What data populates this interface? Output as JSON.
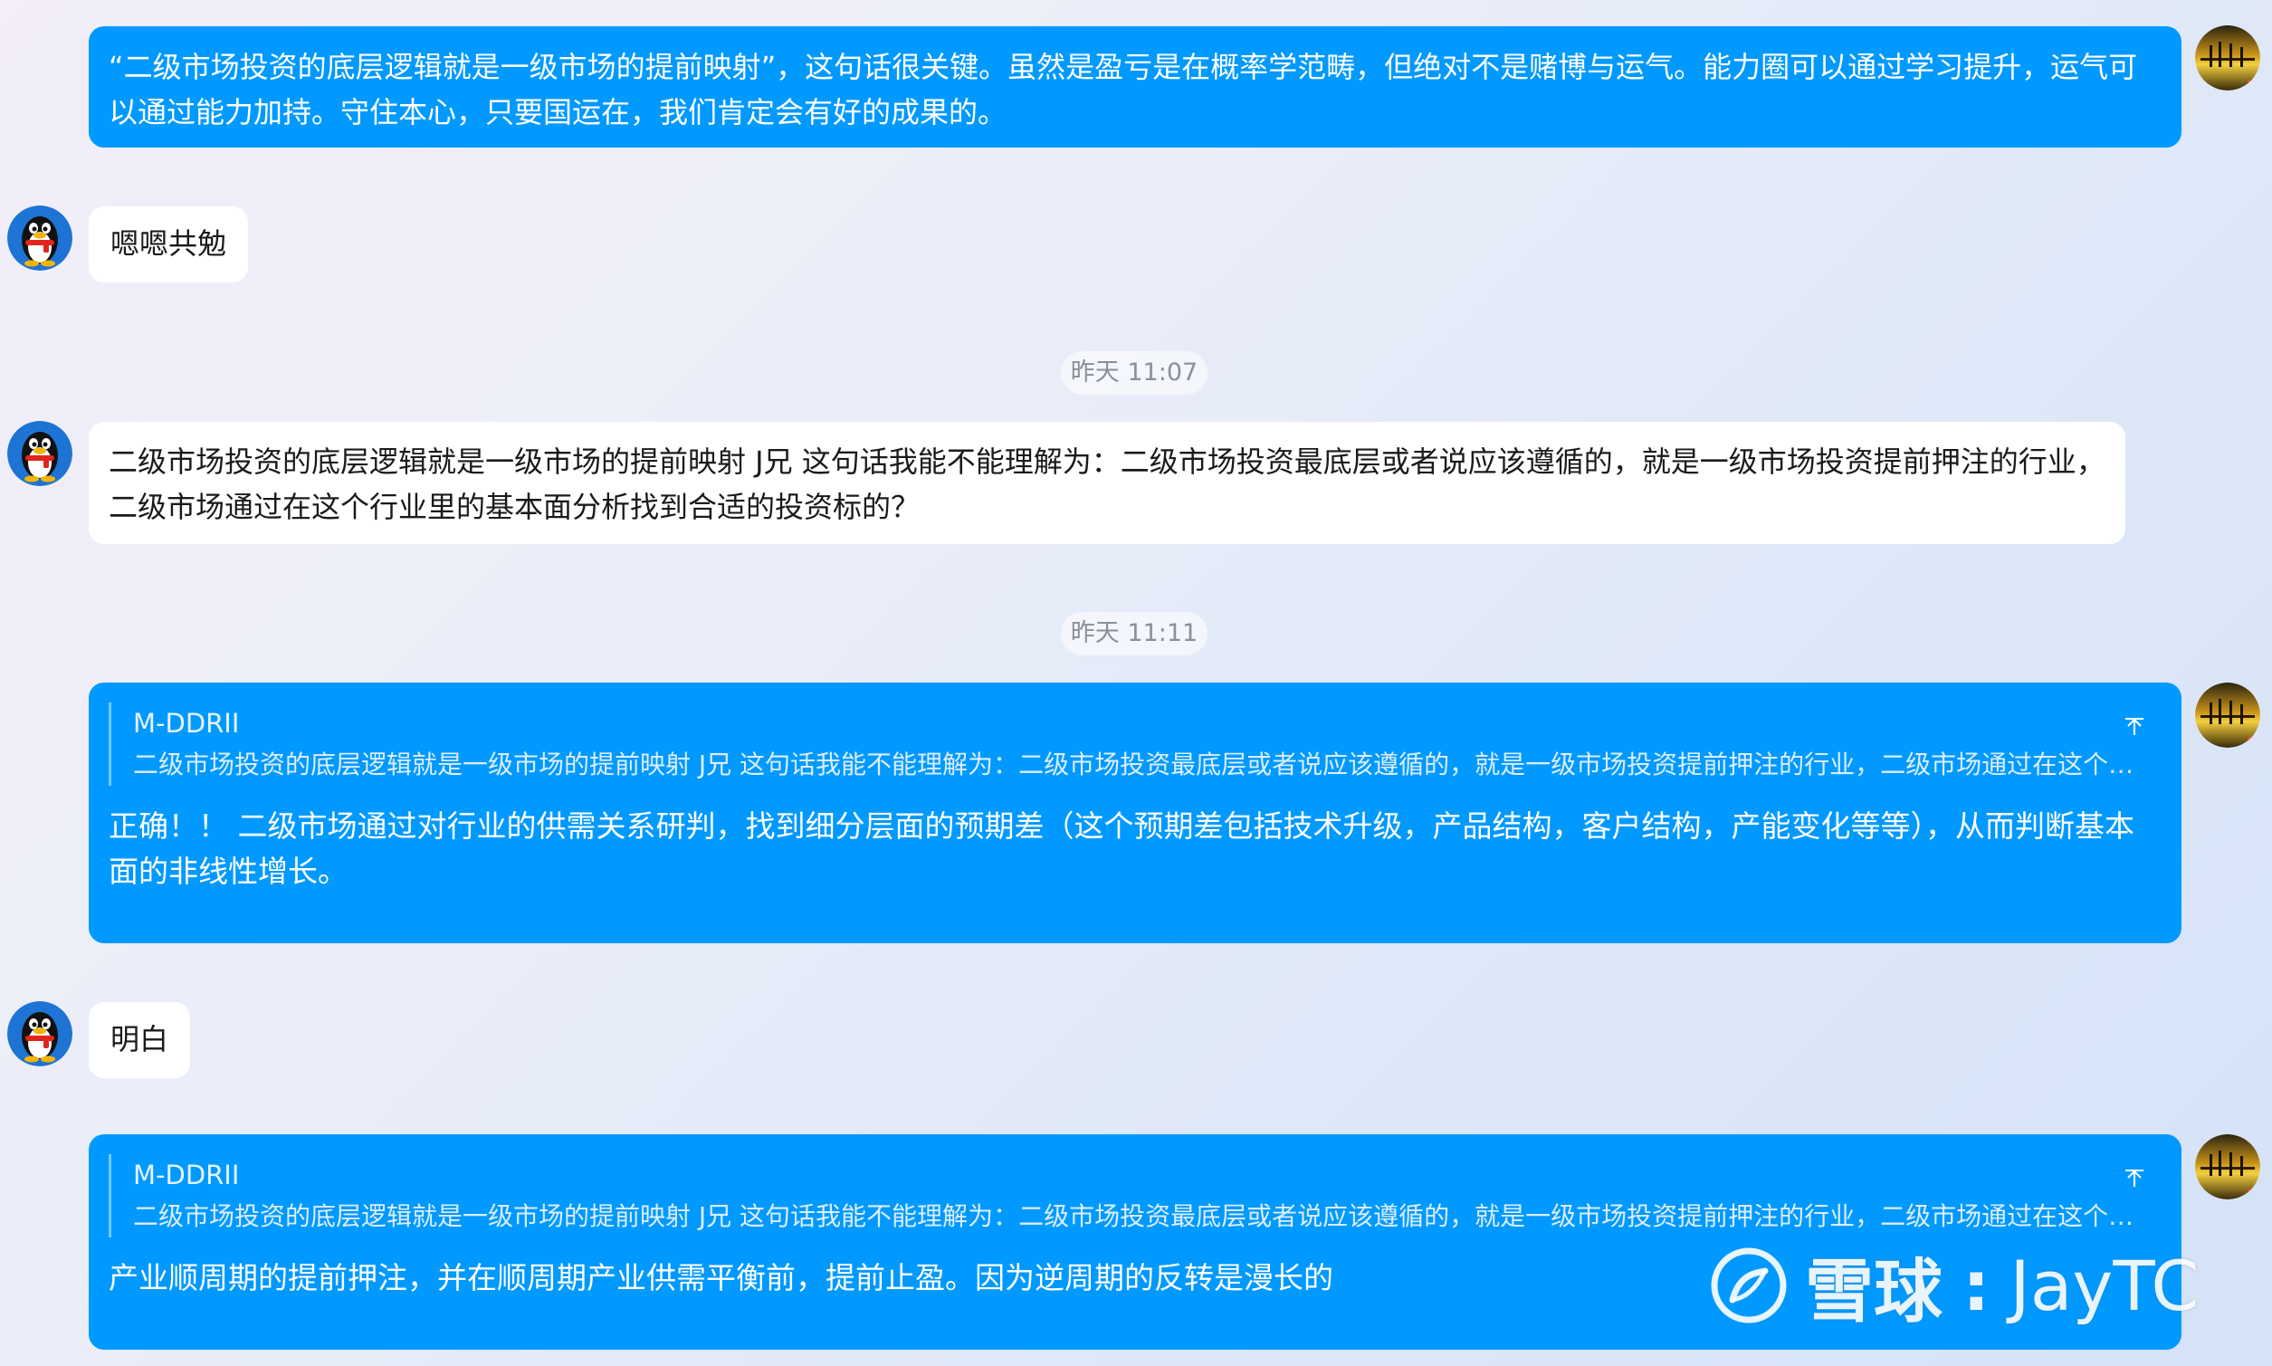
{
  "messages": {
    "m1_text": "“二级市场投资的底层逻辑就是一级市场的提前映射”，这句话很关键。虽然是盈亏是在概率学范畴，但绝对不是赌博与运气。能力圈可以通过学习提升，运气可以通过能力加持。守住本心，只要国运在，我们肯定会有好的成果的。",
    "m2_text": "嗯嗯共勉",
    "t1": "昨天 11:07",
    "m3_text": "二级市场投资的底层逻辑就是一级市场的提前映射  J兄 这句话我能不能理解为：二级市场投资最底层或者说应该遵循的，就是一级市场投资提前押注的行业，二级市场通过在这个行业里的基本面分析找到合适的投资标的？",
    "t2": "昨天 11:11",
    "m4_quote_name": "M-DDRII",
    "m4_quote_text": "二级市场投资的底层逻辑就是一级市场的提前映射 J兄 这句话我能不能理解为：二级市场投资最底层或者说应该遵循的，就是一级市场投资提前押注的行业，二级市场通过在这个行业里的基本面分析找到合适的投资标的？",
    "m4_text": "正确！！ 二级市场通过对行业的供需关系研判，找到细分层面的预期差（这个预期差包括技术升级，产品结构，客户结构，产能变化等等），从而判断基本面的非线性增长。",
    "m5_text": "明白",
    "m6_quote_name": "M-DDRII",
    "m6_quote_text": "二级市场投资的底层逻辑就是一级市场的提前映射 J兄 这句话我能不能理解为：二级市场投资最底层或者说应该遵循的，就是一级市场投资提前押注的行业，二级市场通过在这个行业里的基本面分析找到合适的投资标的？",
    "m6_text": "产业顺周期的提前押注，并在顺周期产业供需平衡前，提前止盈。因为逆周期的反转是漫长的"
  },
  "watermark": {
    "site": "雪球",
    "separator": ":",
    "user": "JayTC"
  },
  "colors": {
    "outgoing_bubble": "#0099ff",
    "incoming_bubble": "#ffffff"
  },
  "icons": {
    "self_avatar": "sunset-avatar",
    "other_avatar": "penguin-avatar",
    "collapse": "collapse-arrow-icon"
  }
}
